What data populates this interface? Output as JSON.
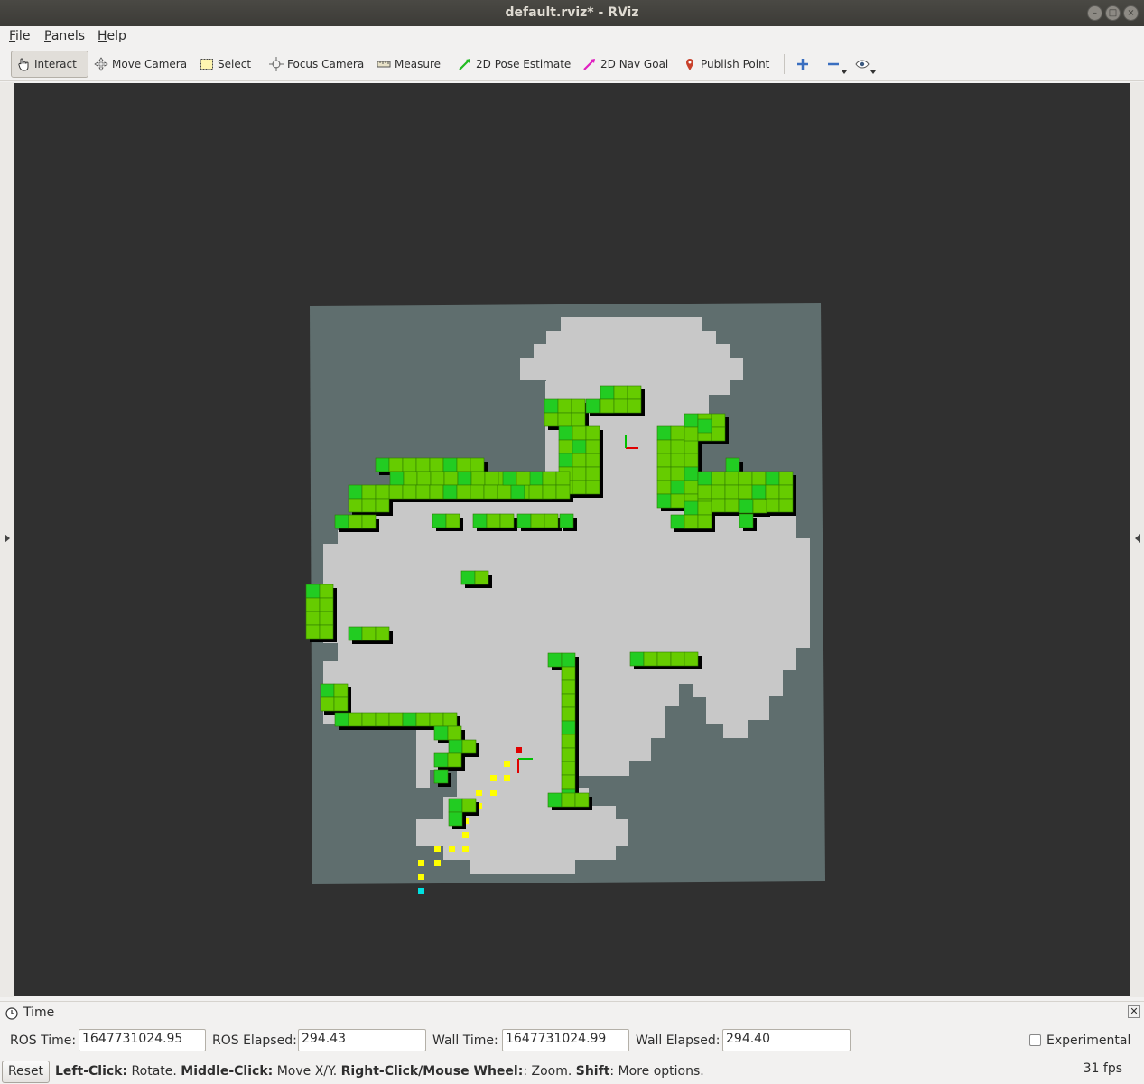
{
  "window": {
    "title": "default.rviz* - RViz",
    "controls": [
      "minimize",
      "maximize",
      "close"
    ]
  },
  "menubar": {
    "items": [
      {
        "label": "File",
        "mnemonic": "F",
        "rest": "ile"
      },
      {
        "label": "Panels",
        "mnemonic": "P",
        "rest": "anels"
      },
      {
        "label": "Help",
        "mnemonic": "H",
        "rest": "elp"
      }
    ]
  },
  "toolbar": {
    "tools": [
      {
        "label": "Interact",
        "icon": "hand-pointer-icon",
        "active": true
      },
      {
        "label": "Move Camera",
        "icon": "move-arrows-icon",
        "active": false
      },
      {
        "label": "Select",
        "icon": "selection-rectangle-icon",
        "active": false
      },
      {
        "label": "Focus Camera",
        "icon": "focus-crosshair-icon",
        "active": false
      },
      {
        "label": "Measure",
        "icon": "ruler-icon",
        "active": false
      },
      {
        "label": "2D Pose Estimate",
        "icon": "green-arrow-icon",
        "active": false
      },
      {
        "label": "2D Nav Goal",
        "icon": "magenta-arrow-icon",
        "active": false
      },
      {
        "label": "Publish Point",
        "icon": "map-pin-icon",
        "active": false
      }
    ],
    "extra_icons": [
      "plus-icon",
      "minus-icon",
      "eye-icon"
    ]
  },
  "viewport": {
    "background_color": "#303030",
    "map_unknown_color": "#5f6e6e",
    "map_free_color": "#c8c8c8",
    "obstacle_color": "#66cc00",
    "path_color": "#ffff00",
    "robot_marker_color": "#00e0e0",
    "goal_marker_color": "#e00000"
  },
  "time_panel": {
    "title": "Time",
    "ros_time_label": "ROS Time:",
    "ros_time": "1647731024.95",
    "ros_elapsed_label": "ROS Elapsed:",
    "ros_elapsed": "294.43",
    "wall_time_label": "Wall Time:",
    "wall_time": "1647731024.99",
    "wall_elapsed_label": "Wall Elapsed:",
    "wall_elapsed": "294.40",
    "experimental_label": "Experimental",
    "experimental_checked": false
  },
  "statusbar": {
    "reset_label": "Reset",
    "hint_left_click": "Left-Click:",
    "hint_left_click_action": " Rotate. ",
    "hint_middle_click": "Middle-Click:",
    "hint_middle_click_action": " Move X/Y. ",
    "hint_right_click": "Right-Click/Mouse Wheel:",
    "hint_right_click_action": ": Zoom. ",
    "hint_shift": "Shift",
    "hint_shift_action": ": More options.",
    "fps": "31 fps"
  }
}
